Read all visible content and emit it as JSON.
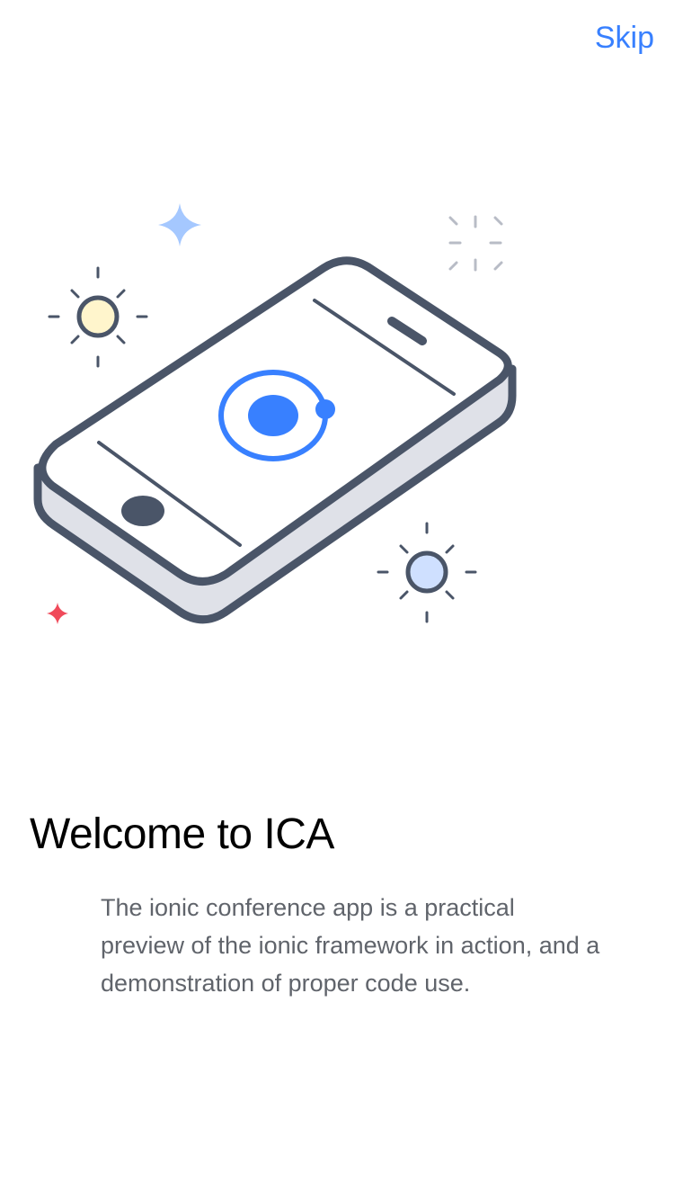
{
  "header": {
    "skip_label": "Skip"
  },
  "slide": {
    "title": "Welcome to ICA",
    "description": "The ionic conference app is a practical preview of the ionic framework in action, and a demonstration of proper code use."
  },
  "illustration": {
    "icon": "phone-with-ionic-logo-icon",
    "colors": {
      "outline": "#4a5568",
      "accent_blue": "#3880ff",
      "light_blue": "#a5c8ff",
      "sun_fill": "#fff5cc",
      "red_star": "#f04a5a",
      "phone_side": "#dfe1e8"
    }
  }
}
